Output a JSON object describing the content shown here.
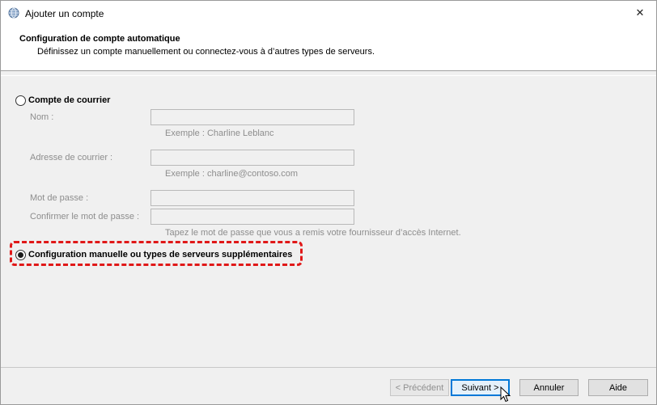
{
  "window": {
    "title": "Ajouter un compte",
    "close_glyph": "✕"
  },
  "header": {
    "title": "Configuration de compte automatique",
    "subtitle": "Définissez un compte manuellement ou connectez-vous à d’autres types de serveurs."
  },
  "email_account": {
    "option_label": "Compte de courrier",
    "selected": false,
    "name_label": "Nom :",
    "name_value": "",
    "name_hint": "Exemple : Charline Leblanc",
    "email_label": "Adresse de courrier :",
    "email_value": "",
    "email_hint": "Exemple : charline@contoso.com",
    "password_label": "Mot de passe :",
    "password_value": "",
    "confirm_label": "Confirmer le mot de passe :",
    "confirm_value": "",
    "password_hint": "Tapez le mot de passe que vous a remis votre fournisseur d’accès Internet."
  },
  "manual_config": {
    "option_label": "Configuration manuelle ou types de serveurs supplémentaires",
    "selected": true
  },
  "buttons": {
    "previous": "< Précédent",
    "next": "Suivant >",
    "cancel": "Annuler",
    "help": "Aide"
  },
  "colors": {
    "highlight": "#e01818",
    "focus_border": "#0078d7"
  }
}
